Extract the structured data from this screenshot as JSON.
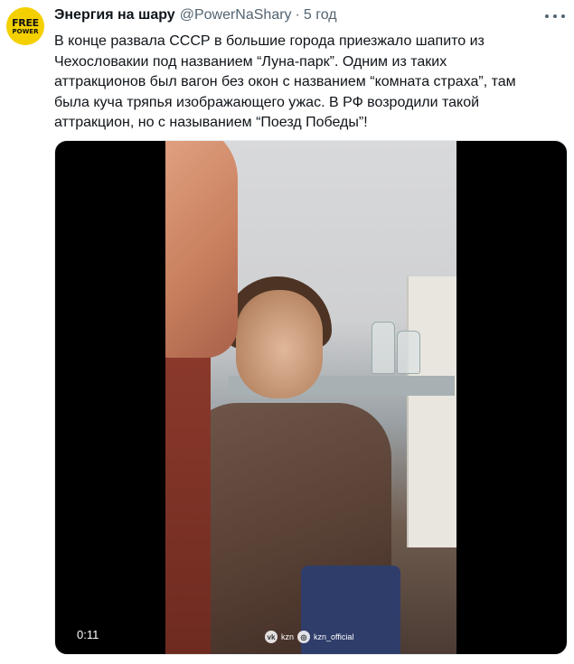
{
  "tweet": {
    "avatar_line1": "FREE",
    "avatar_line2": "POWER",
    "author_name": "Энергия на шару",
    "author_handle": "@PowerNaShary",
    "separator": "·",
    "time": "5 год",
    "text": "В конце развала СССР в большие города приезжало шапито из\nЧехословакии под названием “Луна-парк”. Одним из таких\nаттракционов был вагон без окон с названием “комната страха”, там\nбыла куча тряпья изображающего ужас. В РФ возродили такой\nаттракцион, но с называнием “Поезд Победы”!"
  },
  "video": {
    "timecode": "0:11",
    "watermark_1": "kzn",
    "watermark_2": "kzn_official"
  },
  "colors": {
    "avatar_bg": "#f4d000",
    "secondary_text": "#536471",
    "primary_text": "#0f1419"
  }
}
